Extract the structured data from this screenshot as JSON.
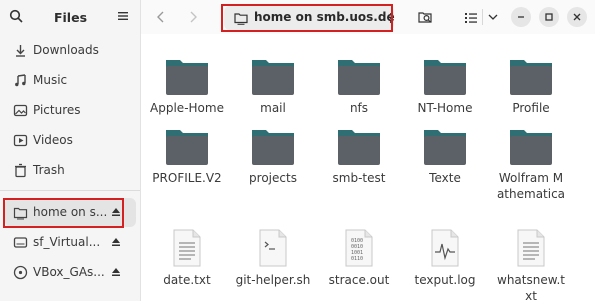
{
  "sidebar": {
    "title": "Files",
    "items": [
      {
        "label": "Downloads",
        "icon": "download-icon"
      },
      {
        "label": "Music",
        "icon": "music-icon"
      },
      {
        "label": "Pictures",
        "icon": "pictures-icon"
      },
      {
        "label": "Videos",
        "icon": "videos-icon"
      },
      {
        "label": "Trash",
        "icon": "trash-icon"
      }
    ],
    "mounts": [
      {
        "label": "home on s...",
        "icon": "network-folder-icon"
      },
      {
        "label": "sf_Virtual...",
        "icon": "drive-icon"
      },
      {
        "label": "VBox_GAs...",
        "icon": "disc-icon"
      }
    ]
  },
  "header": {
    "location": "home on smb.uos.de"
  },
  "folders": [
    {
      "name": "Apple-Home"
    },
    {
      "name": "mail"
    },
    {
      "name": "nfs"
    },
    {
      "name": "NT-Home"
    },
    {
      "name": "Profile"
    },
    {
      "name": "PROFILE.V2"
    },
    {
      "name": "projects"
    },
    {
      "name": "smb-test"
    },
    {
      "name": "Texte"
    },
    {
      "name": "Wolfram Mathematica"
    }
  ],
  "files": [
    {
      "name": "date.txt",
      "kind": "text"
    },
    {
      "name": "git-helper.sh",
      "kind": "script"
    },
    {
      "name": "strace.out",
      "kind": "binary"
    },
    {
      "name": "texput.log",
      "kind": "log"
    },
    {
      "name": "whatsnew.txt",
      "kind": "text"
    }
  ],
  "colors": {
    "folder_top": "#2f6f73",
    "folder_body": "#5b6166",
    "highlight": "#d32020"
  }
}
